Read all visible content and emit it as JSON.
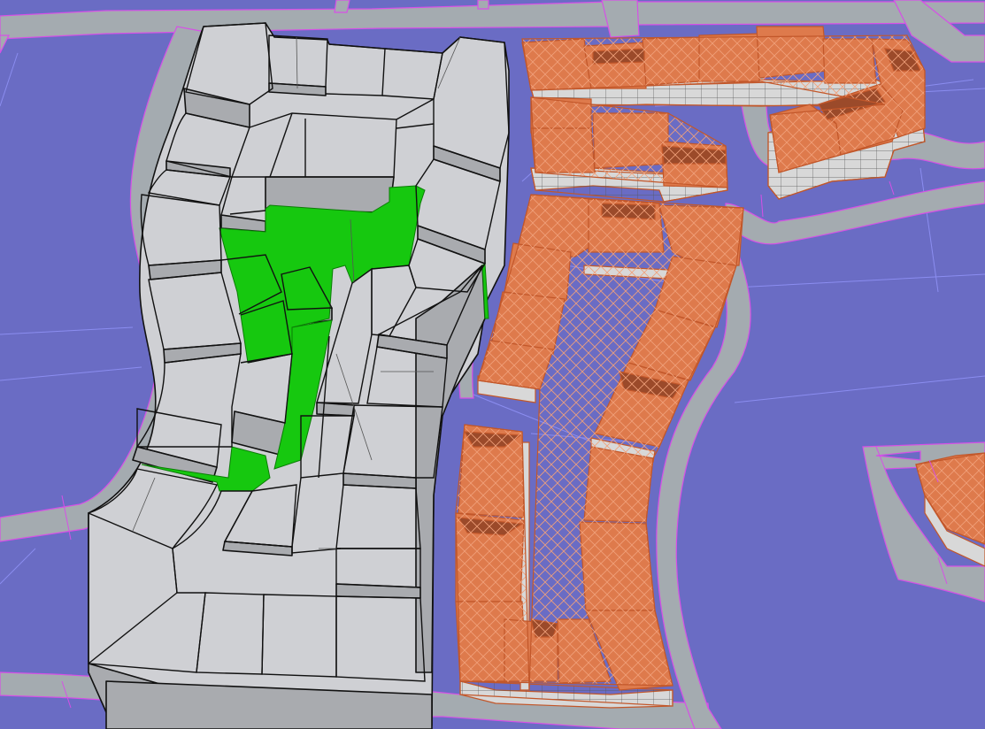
{
  "viewport": {
    "label": "",
    "colors": {
      "parcel": "#6a6cc4",
      "parcel_grid": "#8b8df0",
      "road": "#a4abb0",
      "road_edge": "#d650e6",
      "massing_top": "#cfd0d4",
      "massing_side": "#a9abaf",
      "massing_stroke": "#111111",
      "courtyard": "#16c80f",
      "roof_orange": "#de7a4c",
      "roof_dark": "#9b4a2a",
      "roof_line": "#f0a07a",
      "wall_grey": "#d8d8d8",
      "wall_line": "#666666"
    }
  }
}
